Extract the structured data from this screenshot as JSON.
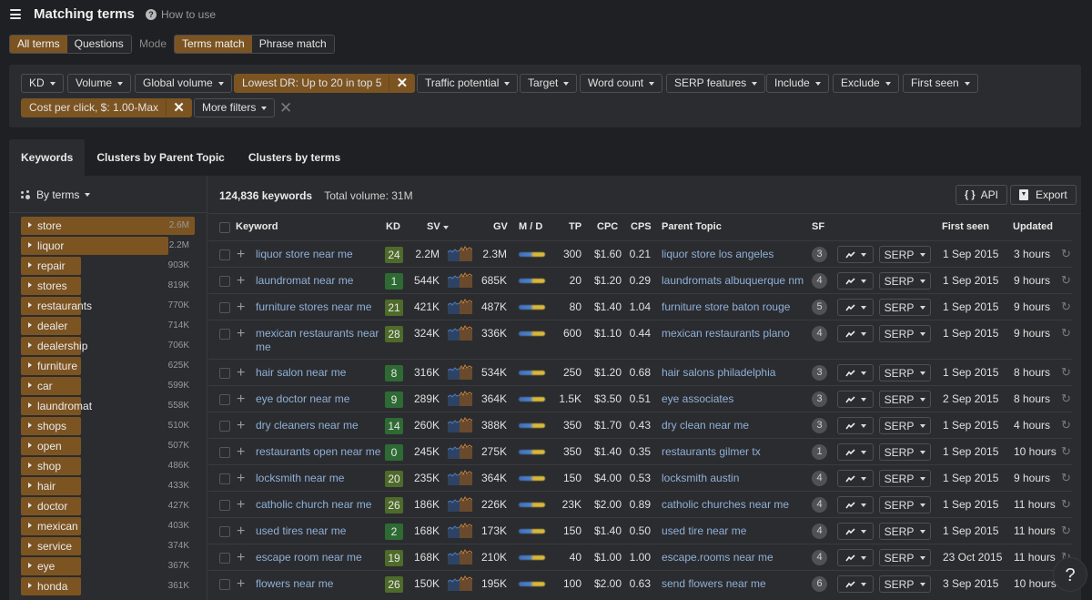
{
  "header": {
    "title": "Matching terms",
    "how_to_use": "How to use",
    "menu_icon": "hamburger-icon",
    "help_icon": "question-circle-icon"
  },
  "term_type": {
    "options": [
      "All terms",
      "Questions"
    ],
    "selected": "All terms"
  },
  "mode": {
    "label": "Mode",
    "options": [
      "Terms match",
      "Phrase match"
    ],
    "selected": "Terms match"
  },
  "filters": {
    "kd": "KD",
    "volume": "Volume",
    "global_volume": "Global volume",
    "lowest_dr": "Lowest DR: Up to 20 in top 5",
    "traffic_potential": "Traffic potential",
    "target": "Target",
    "word_count": "Word count",
    "serp_features": "SERP features",
    "include": "Include",
    "exclude": "Exclude",
    "first_seen": "First seen",
    "cpc": "Cost per click, $: 1.00-Max",
    "more_filters": "More filters",
    "remove_glyph": "✕"
  },
  "tabs": [
    {
      "label": "Keywords",
      "active": true
    },
    {
      "label": "Clusters by Parent Topic",
      "active": false
    },
    {
      "label": "Clusters by terms",
      "active": false
    }
  ],
  "sidebar": {
    "group_by": "By terms",
    "terms": [
      {
        "name": "store",
        "volume": "2.6M",
        "share": 1.0
      },
      {
        "name": "liquor",
        "volume": "2.2M",
        "share": 0.846
      },
      {
        "name": "repair",
        "volume": "903K",
        "share": 0.347
      },
      {
        "name": "stores",
        "volume": "819K",
        "share": 0.315
      },
      {
        "name": "restaurants",
        "volume": "770K",
        "share": 0.296
      },
      {
        "name": "dealer",
        "volume": "714K",
        "share": 0.275
      },
      {
        "name": "dealership",
        "volume": "706K",
        "share": 0.272
      },
      {
        "name": "furniture",
        "volume": "625K",
        "share": 0.24
      },
      {
        "name": "car",
        "volume": "599K",
        "share": 0.23
      },
      {
        "name": "laundromat",
        "volume": "558K",
        "share": 0.215
      },
      {
        "name": "shops",
        "volume": "510K",
        "share": 0.196
      },
      {
        "name": "open",
        "volume": "507K",
        "share": 0.195
      },
      {
        "name": "shop",
        "volume": "486K",
        "share": 0.187
      },
      {
        "name": "hair",
        "volume": "433K",
        "share": 0.167
      },
      {
        "name": "doctor",
        "volume": "427K",
        "share": 0.164
      },
      {
        "name": "mexican",
        "volume": "403K",
        "share": 0.155
      },
      {
        "name": "service",
        "volume": "374K",
        "share": 0.144
      },
      {
        "name": "eye",
        "volume": "367K",
        "share": 0.141
      },
      {
        "name": "honda",
        "volume": "361K",
        "share": 0.139
      }
    ]
  },
  "results": {
    "count": "124,836 keywords",
    "total_volume": "Total volume: 31M",
    "api_label": "API",
    "export_label": "Export"
  },
  "columns": {
    "keyword": "Keyword",
    "kd": "KD",
    "sv": "SV",
    "gv": "GV",
    "md": "M / D",
    "tp": "TP",
    "cpc": "CPC",
    "cps": "CPS",
    "parent_topic": "Parent Topic",
    "sf": "SF",
    "first_seen": "First seen",
    "updated": "Updated",
    "serp_label": "SERP"
  },
  "colors": {
    "accent": "#7c5422",
    "kd_very_easy": "#2e6b34",
    "kd_easy": "#4e6b2a",
    "link": "#8fb0d8",
    "spark_blue": "#4a78b8",
    "spark_orange": "#c8803a"
  },
  "rows": [
    {
      "keyword": "liquor store near me",
      "kd": "24",
      "sv": "2.2M",
      "gv": "2.3M",
      "tp": "300",
      "cpc": "$1.60",
      "cps": "0.21",
      "parent_topic": "liquor store los angeles",
      "sf": "3",
      "first_seen": "1 Sep 2015",
      "updated": "3 hours"
    },
    {
      "keyword": "laundromat near me",
      "kd": "1",
      "sv": "544K",
      "gv": "685K",
      "tp": "20",
      "cpc": "$1.20",
      "cps": "0.29",
      "parent_topic": "laundromats albuquerque nm",
      "sf": "4",
      "first_seen": "1 Sep 2015",
      "updated": "9 hours"
    },
    {
      "keyword": "furniture stores near me",
      "kd": "21",
      "sv": "421K",
      "gv": "487K",
      "tp": "80",
      "cpc": "$1.40",
      "cps": "1.04",
      "parent_topic": "furniture store baton rouge",
      "sf": "5",
      "first_seen": "1 Sep 2015",
      "updated": "9 hours"
    },
    {
      "keyword": "mexican restaurants near me",
      "kd": "28",
      "sv": "324K",
      "gv": "336K",
      "tp": "600",
      "cpc": "$1.10",
      "cps": "0.44",
      "parent_topic": "mexican restaurants plano",
      "sf": "4",
      "first_seen": "1 Sep 2015",
      "updated": "9 hours"
    },
    {
      "keyword": "hair salon near me",
      "kd": "8",
      "sv": "316K",
      "gv": "534K",
      "tp": "250",
      "cpc": "$1.20",
      "cps": "0.68",
      "parent_topic": "hair salons philadelphia",
      "sf": "3",
      "first_seen": "1 Sep 2015",
      "updated": "8 hours"
    },
    {
      "keyword": "eye doctor near me",
      "kd": "9",
      "sv": "289K",
      "gv": "364K",
      "tp": "1.5K",
      "cpc": "$3.50",
      "cps": "0.51",
      "parent_topic": "eye associates",
      "sf": "3",
      "first_seen": "2 Sep 2015",
      "updated": "8 hours"
    },
    {
      "keyword": "dry cleaners near me",
      "kd": "14",
      "sv": "260K",
      "gv": "388K",
      "tp": "350",
      "cpc": "$1.70",
      "cps": "0.43",
      "parent_topic": "dry clean near me",
      "sf": "3",
      "first_seen": "1 Sep 2015",
      "updated": "4 hours"
    },
    {
      "keyword": "restaurants open near me",
      "kd": "0",
      "sv": "245K",
      "gv": "275K",
      "tp": "350",
      "cpc": "$1.40",
      "cps": "0.35",
      "parent_topic": "restaurants gilmer tx",
      "sf": "1",
      "first_seen": "1 Sep 2015",
      "updated": "10 hours"
    },
    {
      "keyword": "locksmith near me",
      "kd": "20",
      "sv": "235K",
      "gv": "364K",
      "tp": "150",
      "cpc": "$4.00",
      "cps": "0.53",
      "parent_topic": "locksmith austin",
      "sf": "4",
      "first_seen": "1 Sep 2015",
      "updated": "9 hours"
    },
    {
      "keyword": "catholic church near me",
      "kd": "26",
      "sv": "186K",
      "gv": "226K",
      "tp": "23K",
      "cpc": "$2.00",
      "cps": "0.89",
      "parent_topic": "catholic churches near me",
      "sf": "4",
      "first_seen": "1 Sep 2015",
      "updated": "11 hours"
    },
    {
      "keyword": "used tires near me",
      "kd": "2",
      "sv": "168K",
      "gv": "173K",
      "tp": "150",
      "cpc": "$1.40",
      "cps": "0.50",
      "parent_topic": "used tire near me",
      "sf": "4",
      "first_seen": "1 Sep 2015",
      "updated": "11 hours"
    },
    {
      "keyword": "escape room near me",
      "kd": "19",
      "sv": "168K",
      "gv": "210K",
      "tp": "40",
      "cpc": "$1.00",
      "cps": "1.00",
      "parent_topic": "escape.rooms near me",
      "sf": "4",
      "first_seen": "23 Oct 2015",
      "updated": "11 hours"
    },
    {
      "keyword": "flowers near me",
      "kd": "26",
      "sv": "150K",
      "gv": "195K",
      "tp": "100",
      "cpc": "$2.00",
      "cps": "0.63",
      "parent_topic": "send flowers near me",
      "sf": "6",
      "first_seen": "3 Sep 2015",
      "updated": "10 hours"
    }
  ]
}
